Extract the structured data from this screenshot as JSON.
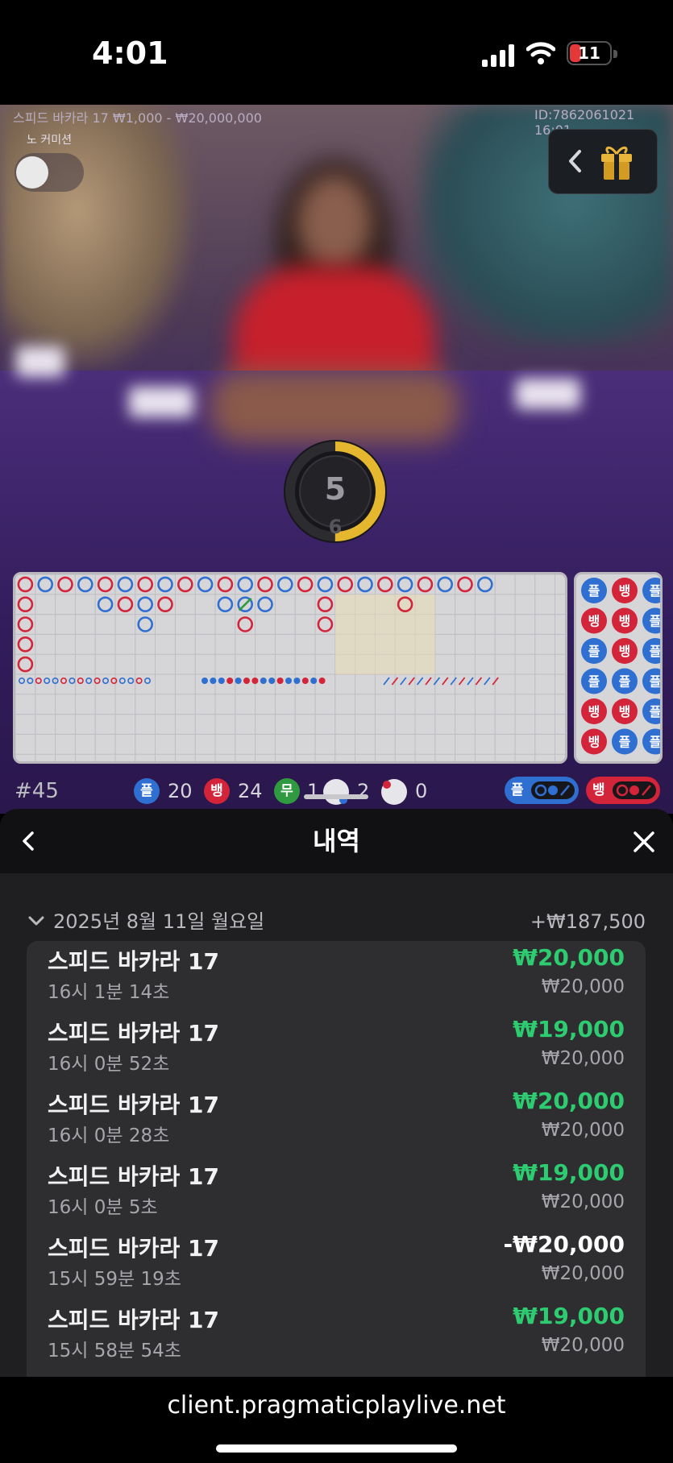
{
  "status_bar": {
    "time": "4:01",
    "battery": "11",
    "icons": [
      "cellular-signal-icon",
      "wifi-icon",
      "battery-icon"
    ]
  },
  "game": {
    "table_info": "스피드 바카라 17  ₩1,000 - ₩20,000,000",
    "round_id": "ID:7862061021  16:01",
    "no_commission_label": "노 커미션",
    "timer_value": "5",
    "timer_next": "6",
    "timer_progress_fraction": 0.5
  },
  "scoreboard": {
    "shoe_number": "#45",
    "player_chip": "플",
    "player_count": "20",
    "banker_chip": "뱅",
    "banker_count": "24",
    "tie_chip": "무",
    "tie_count": "1",
    "player_pair_count": "2",
    "banker_pair_count": "0",
    "player_predict_label": "플",
    "banker_predict_label": "뱅",
    "big_road": [
      [
        "B",
        "P",
        "B",
        "P",
        "B",
        "P",
        "B",
        "P",
        "B",
        "P",
        "B",
        "P",
        "B",
        "P",
        "B",
        "P",
        "B",
        "P",
        "B",
        "P",
        "B",
        "P",
        "B",
        "P"
      ],
      [
        "B",
        "",
        "",
        "",
        "P",
        "B",
        "P",
        "B",
        "",
        "",
        "P",
        "G",
        "P",
        "",
        "",
        "B",
        "",
        "",
        "",
        "B",
        "",
        "",
        "",
        ""
      ],
      [
        "B",
        "",
        "",
        "",
        "",
        "",
        "P",
        "",
        "",
        "",
        "",
        "B",
        "",
        "",
        "",
        "B",
        "",
        "",
        "",
        "",
        "",
        "",
        "",
        ""
      ],
      [
        "B",
        "",
        "",
        "",
        "",
        "",
        "",
        "",
        "",
        "",
        "",
        "",
        "",
        "",
        "",
        "",
        "",
        "",
        "",
        "",
        "",
        "",
        "",
        ""
      ],
      [
        "B",
        "",
        "",
        "",
        "",
        "",
        "",
        "",
        "",
        "",
        "",
        "",
        "",
        "",
        "",
        "",
        "",
        "",
        "",
        "",
        "",
        "",
        "",
        ""
      ]
    ],
    "bead_plate": [
      [
        "P",
        "B",
        "P"
      ],
      [
        "B",
        "B",
        "P"
      ],
      [
        "P",
        "B",
        "P"
      ],
      [
        "P",
        "P",
        "P"
      ],
      [
        "B",
        "B",
        "P"
      ],
      [
        "B",
        "P",
        "P"
      ]
    ]
  },
  "history_panel": {
    "title": "내역",
    "date": "2025년 8월 11일 월요일",
    "day_total": "+₩187,500",
    "colors": {
      "win": "#2ecc71",
      "loss": "#ffffff"
    },
    "rows": [
      {
        "name": "스피드 바카라 17",
        "time": "16시 1분 14초",
        "amount": "₩20,000",
        "bet": "₩20,000",
        "result": "win"
      },
      {
        "name": "스피드 바카라 17",
        "time": "16시 0분 52초",
        "amount": "₩19,000",
        "bet": "₩20,000",
        "result": "win"
      },
      {
        "name": "스피드 바카라 17",
        "time": "16시 0분 28초",
        "amount": "₩20,000",
        "bet": "₩20,000",
        "result": "win"
      },
      {
        "name": "스피드 바카라 17",
        "time": "16시 0분 5초",
        "amount": "₩19,000",
        "bet": "₩20,000",
        "result": "win"
      },
      {
        "name": "스피드 바카라 17",
        "time": "15시 59분 19초",
        "amount": "-₩20,000",
        "bet": "₩20,000",
        "result": "loss"
      },
      {
        "name": "스피드 바카라 17",
        "time": "15시 58분 54초",
        "amount": "₩19,000",
        "bet": "₩20,000",
        "result": "win"
      }
    ]
  },
  "browser": {
    "url": "client.pragmaticplaylive.net"
  }
}
